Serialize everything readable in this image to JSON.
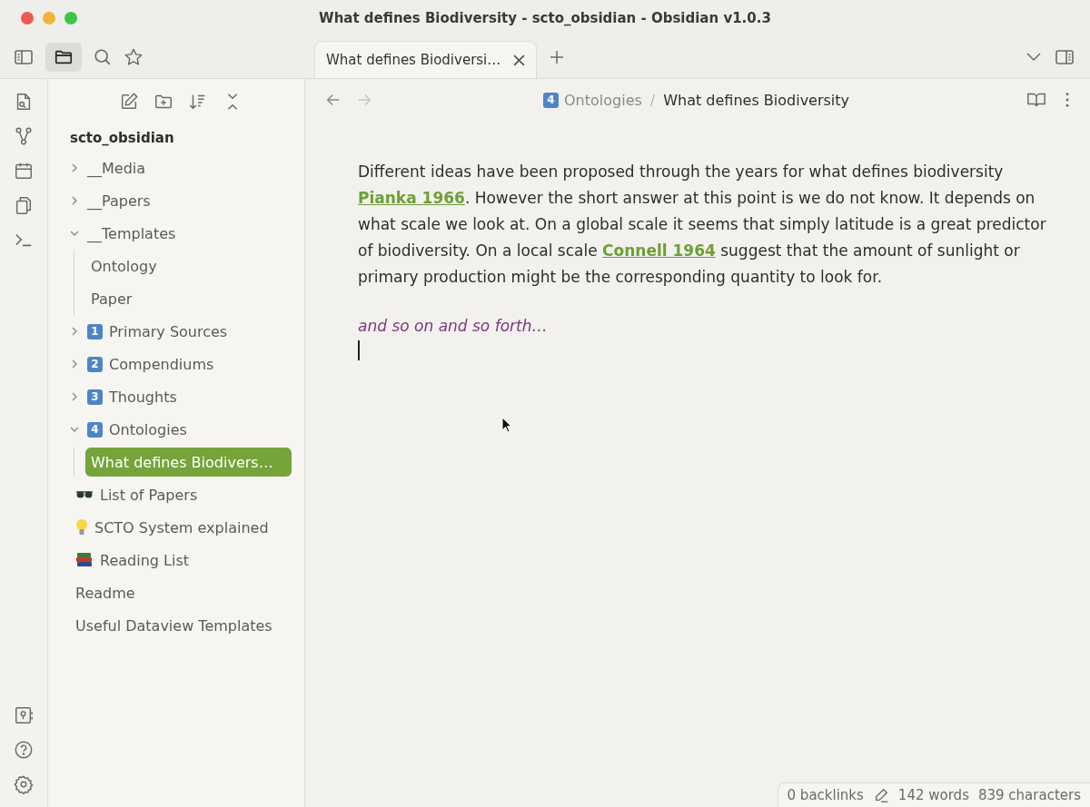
{
  "window": {
    "title": "What defines Biodiversity - scto_obsidian - Obsidian v1.0.3"
  },
  "tabs": [
    {
      "label": "What defines Biodiversi…",
      "selected": true
    }
  ],
  "sidebar": {
    "vault": "scto_obsidian",
    "items": [
      {
        "label": "__Media",
        "kind": "folder",
        "expanded": false
      },
      {
        "label": "__Papers",
        "kind": "folder",
        "expanded": false
      },
      {
        "label": "__Templates",
        "kind": "folder",
        "expanded": true,
        "children": [
          {
            "label": "Ontology",
            "kind": "file",
            "selected": false
          },
          {
            "label": "Paper",
            "kind": "file",
            "selected": false
          }
        ]
      },
      {
        "label": "Primary Sources",
        "badge": "1",
        "kind": "folder",
        "expanded": false
      },
      {
        "label": "Compendiums",
        "badge": "2",
        "kind": "folder",
        "expanded": false
      },
      {
        "label": "Thoughts",
        "badge": "3",
        "kind": "folder",
        "expanded": false
      },
      {
        "label": "Ontologies",
        "badge": "4",
        "kind": "folder",
        "expanded": true,
        "children": [
          {
            "label": "What defines Biodivers…",
            "kind": "file",
            "selected": true
          }
        ]
      },
      {
        "label": "List of Papers",
        "kind": "glasses",
        "selected": false
      },
      {
        "label": "SCTO System explained",
        "kind": "bulb",
        "selected": false
      },
      {
        "label": "Reading List",
        "kind": "books",
        "selected": false
      },
      {
        "label": "Readme",
        "kind": "file",
        "selected": false
      },
      {
        "label": "Useful Dataview Templates",
        "kind": "file",
        "selected": false
      }
    ]
  },
  "breadcrumb": {
    "folder_badge": "4",
    "folder": "Ontologies",
    "separator": "/",
    "note": "What defines Biodiversity"
  },
  "note": {
    "paragraph": [
      {
        "text": "Different ideas have been proposed through the years for what defines biodiversity ",
        "kind": "text"
      },
      {
        "text": "Pianka 1966",
        "kind": "link"
      },
      {
        "text": ". However the short answer at this point is we do not know. It depends on what scale we look at. On a global scale it seems that simply latitude is a great predictor of biodiversity. On a local scale ",
        "kind": "text"
      },
      {
        "text": "Connell 1964",
        "kind": "link"
      },
      {
        "text": " suggest that the amount of sunlight or primary production might be the corresponding quantity to look for.",
        "kind": "text"
      }
    ],
    "italic_line": "and so on and so forth…"
  },
  "status_bar": {
    "backlinks": "0 backlinks",
    "words": "142 words",
    "characters": "839 characters"
  }
}
